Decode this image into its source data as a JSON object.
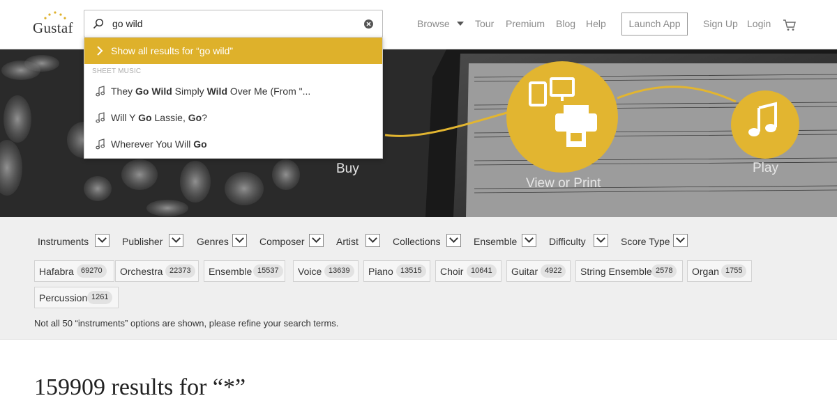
{
  "header": {
    "logo_text": "Gustaf",
    "search": {
      "value": "go wild",
      "placeholder": ""
    },
    "nav": {
      "browse": "Browse",
      "tour": "Tour",
      "premium": "Premium",
      "blog": "Blog",
      "help": "Help",
      "launch_app": "Launch App",
      "sign_up": "Sign Up",
      "login": "Login"
    }
  },
  "dropdown": {
    "show_all": "Show all results for “go wild”",
    "section": "SHEET MUSIC",
    "items": [
      {
        "parts": [
          [
            "They ",
            false
          ],
          [
            "Go Wild",
            true
          ],
          [
            " Simply ",
            false
          ],
          [
            "Wild",
            true
          ],
          [
            " Over Me (From \"...",
            false
          ]
        ]
      },
      {
        "parts": [
          [
            "Will Y ",
            false
          ],
          [
            "Go",
            true
          ],
          [
            " Lassie, ",
            false
          ],
          [
            "Go",
            true
          ],
          [
            "?",
            false
          ]
        ]
      },
      {
        "parts": [
          [
            "Wherever You Will ",
            false
          ],
          [
            "Go",
            true
          ]
        ]
      }
    ]
  },
  "hero": {
    "buy": "Buy",
    "view_print": "View or Print",
    "play": "Play"
  },
  "filters": {
    "tabs": [
      "Instruments",
      "Publisher",
      "Genres",
      "Composer",
      "Artist",
      "Collections",
      "Ensemble",
      "Difficulty",
      "Score Type"
    ],
    "chips": [
      {
        "label": "Hafabra",
        "count": "69270"
      },
      {
        "label": "Orchestra",
        "count": "22373"
      },
      {
        "label": "Ensemble",
        "count": "15537"
      },
      {
        "label": "Voice",
        "count": "13639"
      },
      {
        "label": "Piano",
        "count": "13515"
      },
      {
        "label": "Choir",
        "count": "10641"
      },
      {
        "label": "Guitar",
        "count": "4922"
      },
      {
        "label": "String Ensemble",
        "count": "2578"
      },
      {
        "label": "Organ",
        "count": "1755"
      },
      {
        "label": "Percussion",
        "count": "1261"
      }
    ],
    "note": "Not all 50 “instruments” options are shown, please refine your search terms."
  },
  "results": {
    "title": "159909 results for “*”"
  },
  "colors": {
    "accent": "#deb12b",
    "hero_circle": "#e2b530"
  }
}
